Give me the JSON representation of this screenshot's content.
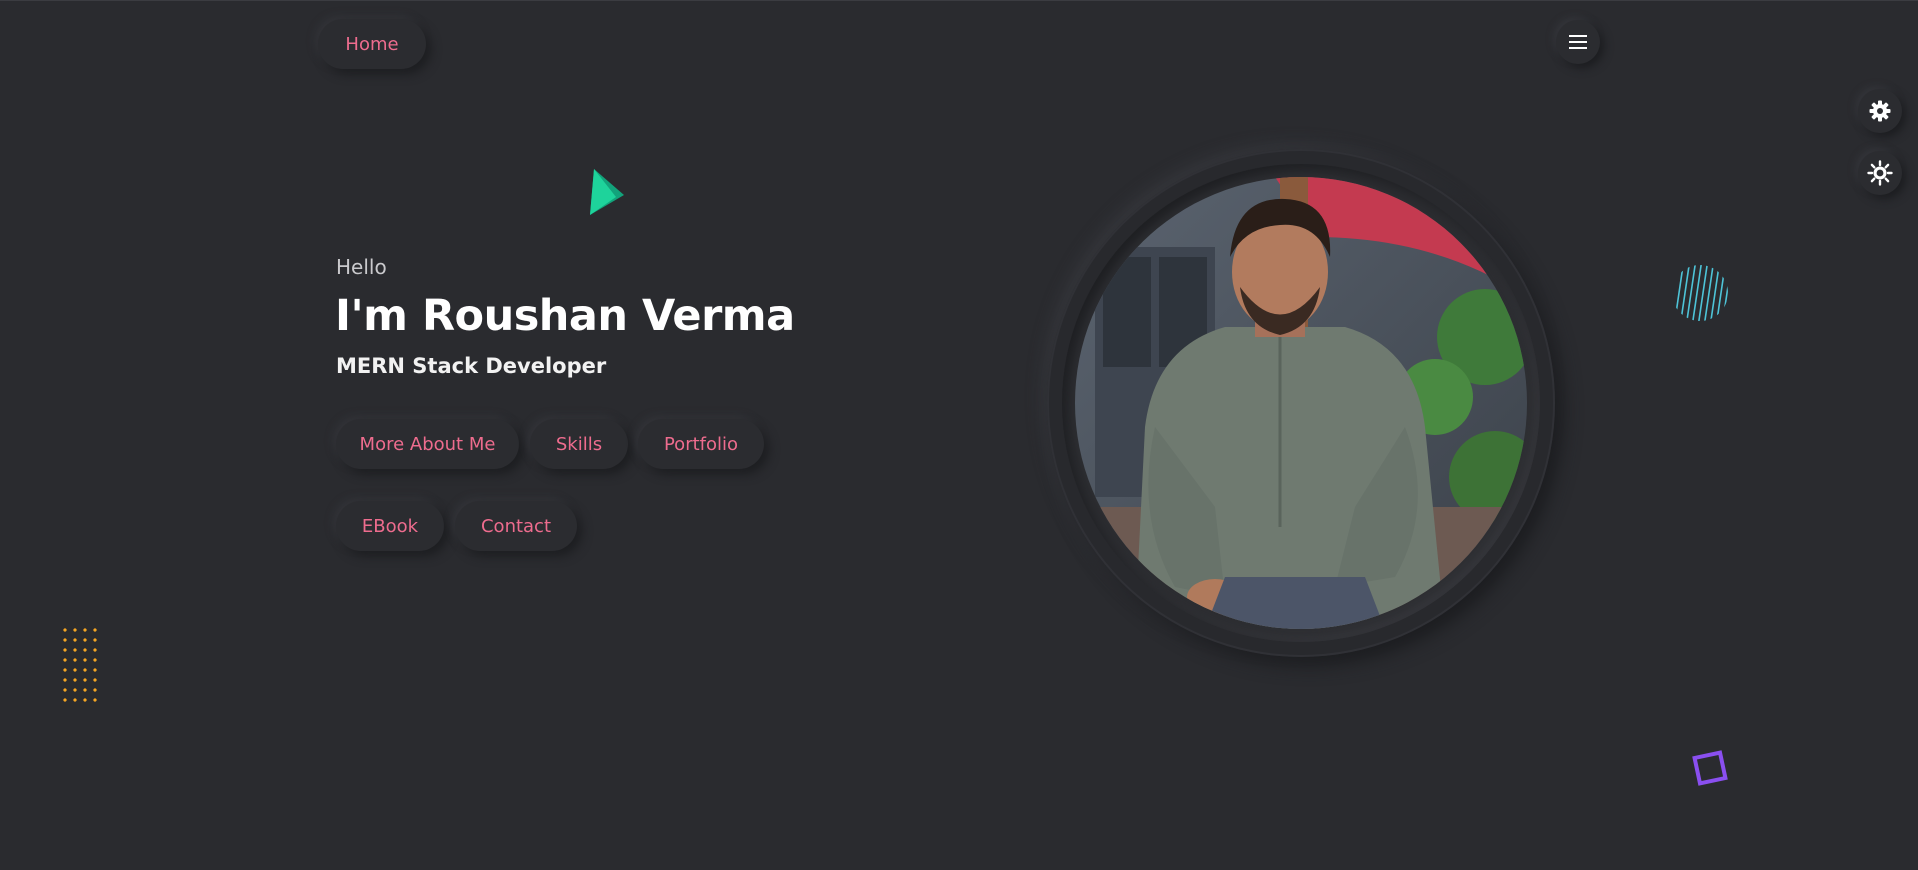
{
  "nav": {
    "home_label": "Home",
    "menu_icon": "hamburger-menu-icon"
  },
  "side_controls": {
    "settings_icon": "gear-icon",
    "theme_icon": "sun-icon"
  },
  "hero": {
    "greeting": "Hello",
    "name": "I'm Roushan Verma",
    "title": "MERN Stack Developer",
    "buttons": [
      "More About Me",
      "Skills",
      "Portfolio",
      "EBook",
      "Contact"
    ]
  },
  "profile_photo": {
    "description": "profile-photo",
    "ring_color": "#28292d"
  },
  "decorations": {
    "triangle_color": "#1ec98f",
    "dots_color": "#f5a623",
    "stripes_color": "#4ec4d8",
    "square_color": "#8a4ff0"
  },
  "theme": {
    "background": "#2a2b2f",
    "accent": "#ee6c8e",
    "text": "#ffffff"
  }
}
